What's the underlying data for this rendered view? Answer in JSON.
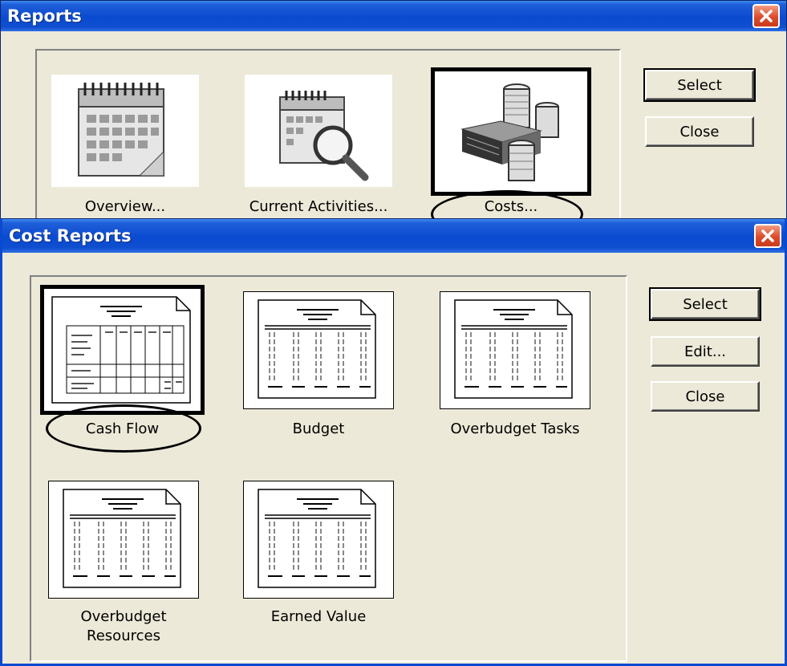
{
  "reports": {
    "title": "Reports",
    "tiles": [
      {
        "label": "Overview...",
        "icon": "calendar-icon"
      },
      {
        "label": "Current Activities...",
        "icon": "calendar-magnifier-icon"
      },
      {
        "label": "Costs...",
        "icon": "coins-stack-icon"
      }
    ],
    "buttons": {
      "select": "Select",
      "close": "Close"
    }
  },
  "cost_reports": {
    "title": "Cost Reports",
    "tiles": [
      {
        "label": "Cash Flow",
        "icon": "cash-flow-report-icon"
      },
      {
        "label": "Budget",
        "icon": "budget-report-icon"
      },
      {
        "label": "Overbudget Tasks",
        "icon": "overbudget-tasks-report-icon"
      },
      {
        "label": "Overbudget Resources",
        "label_line1": "Overbudget",
        "label_line2": "Resources",
        "icon": "overbudget-resources-report-icon"
      },
      {
        "label": "Earned Value",
        "icon": "earned-value-report-icon"
      }
    ],
    "buttons": {
      "select": "Select",
      "edit": "Edit...",
      "close": "Close"
    }
  },
  "colors": {
    "title_blue": "#0a4ad0",
    "close_red": "#dd4b2b",
    "dialog_bg": "#ece9d8"
  }
}
